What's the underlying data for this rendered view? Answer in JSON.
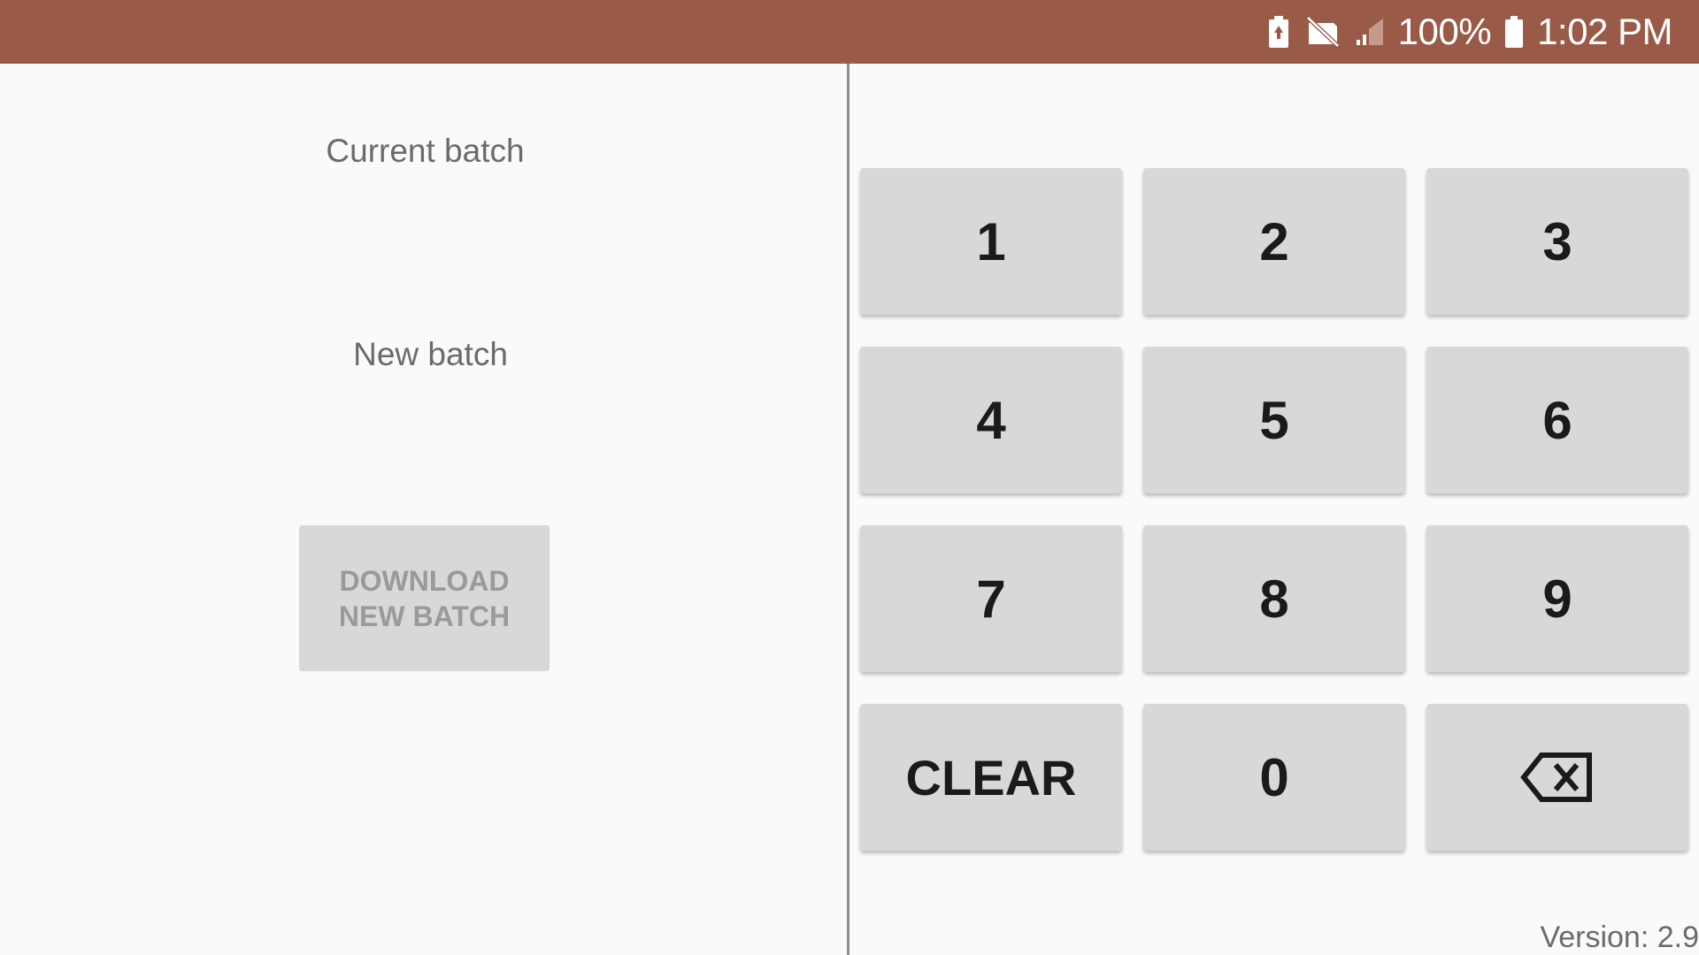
{
  "status_bar": {
    "background": "#9a5a48",
    "icons": [
      "battery-saver-icon",
      "no-sim-icon",
      "signal-strength-icon",
      "battery-icon"
    ],
    "battery_percent": "100%",
    "time": "1:02 PM"
  },
  "left": {
    "current_batch_label": "Current batch",
    "new_batch_label": "New batch",
    "download_button": {
      "line1": "DOWNLOAD",
      "line2": "NEW BATCH"
    }
  },
  "keypad": {
    "keys": [
      "1",
      "2",
      "3",
      "4",
      "5",
      "6",
      "7",
      "8",
      "9",
      "CLEAR",
      "0",
      "backspace"
    ],
    "labels": {
      "k1": "1",
      "k2": "2",
      "k3": "3",
      "k4": "4",
      "k5": "5",
      "k6": "6",
      "k7": "7",
      "k8": "8",
      "k9": "9",
      "clear": "CLEAR",
      "k0": "0",
      "backspace_icon": "backspace-icon"
    }
  },
  "footer": {
    "version": "Version: 2.9"
  }
}
